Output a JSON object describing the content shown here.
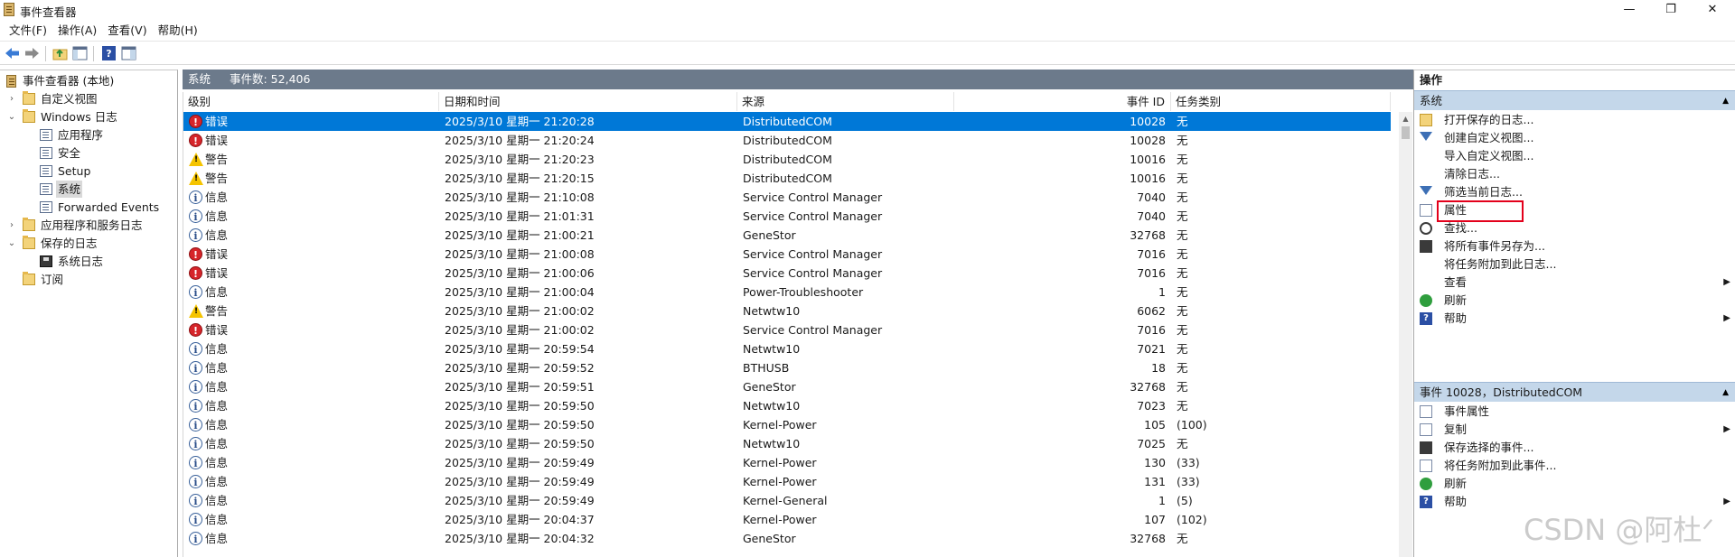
{
  "window": {
    "title": "事件查看器",
    "minimize": "—",
    "maximize": "❐",
    "close": "✕"
  },
  "menu": [
    "文件(F)",
    "操作(A)",
    "查看(V)",
    "帮助(H)"
  ],
  "tree": {
    "root": "事件查看器 (本地)",
    "custom_views": "自定义视图",
    "windows_logs": "Windows 日志",
    "app": "应用程序",
    "security": "安全",
    "setup": "Setup",
    "system": "系统",
    "forwarded": "Forwarded Events",
    "app_services": "应用程序和服务日志",
    "saved_logs": "保存的日志",
    "system_log": "系统日志",
    "subscriptions": "订阅"
  },
  "center": {
    "log_name": "系统",
    "event_count": "事件数: 52,406",
    "columns": {
      "level": "级别",
      "datetime": "日期和时间",
      "source": "来源",
      "event_id": "事件 ID",
      "task": "任务类别"
    },
    "rows": [
      {
        "level": "错误",
        "type": "err",
        "datetime": "2025/3/10 星期一 21:20:28",
        "source": "DistributedCOM",
        "id": "10028",
        "task": "无"
      },
      {
        "level": "错误",
        "type": "err",
        "datetime": "2025/3/10 星期一 21:20:24",
        "source": "DistributedCOM",
        "id": "10028",
        "task": "无"
      },
      {
        "level": "警告",
        "type": "warn",
        "datetime": "2025/3/10 星期一 21:20:23",
        "source": "DistributedCOM",
        "id": "10016",
        "task": "无"
      },
      {
        "level": "警告",
        "type": "warn",
        "datetime": "2025/3/10 星期一 21:20:15",
        "source": "DistributedCOM",
        "id": "10016",
        "task": "无"
      },
      {
        "level": "信息",
        "type": "info",
        "datetime": "2025/3/10 星期一 21:10:08",
        "source": "Service Control Manager",
        "id": "7040",
        "task": "无"
      },
      {
        "level": "信息",
        "type": "info",
        "datetime": "2025/3/10 星期一 21:01:31",
        "source": "Service Control Manager",
        "id": "7040",
        "task": "无"
      },
      {
        "level": "信息",
        "type": "info",
        "datetime": "2025/3/10 星期一 21:00:21",
        "source": "GeneStor",
        "id": "32768",
        "task": "无"
      },
      {
        "level": "错误",
        "type": "err",
        "datetime": "2025/3/10 星期一 21:00:08",
        "source": "Service Control Manager",
        "id": "7016",
        "task": "无"
      },
      {
        "level": "错误",
        "type": "err",
        "datetime": "2025/3/10 星期一 21:00:06",
        "source": "Service Control Manager",
        "id": "7016",
        "task": "无"
      },
      {
        "level": "信息",
        "type": "info",
        "datetime": "2025/3/10 星期一 21:00:04",
        "source": "Power-Troubleshooter",
        "id": "1",
        "task": "无"
      },
      {
        "level": "警告",
        "type": "warn",
        "datetime": "2025/3/10 星期一 21:00:02",
        "source": "Netwtw10",
        "id": "6062",
        "task": "无"
      },
      {
        "level": "错误",
        "type": "err",
        "datetime": "2025/3/10 星期一 21:00:02",
        "source": "Service Control Manager",
        "id": "7016",
        "task": "无"
      },
      {
        "level": "信息",
        "type": "info",
        "datetime": "2025/3/10 星期一 20:59:54",
        "source": "Netwtw10",
        "id": "7021",
        "task": "无"
      },
      {
        "level": "信息",
        "type": "info",
        "datetime": "2025/3/10 星期一 20:59:52",
        "source": "BTHUSB",
        "id": "18",
        "task": "无"
      },
      {
        "level": "信息",
        "type": "info",
        "datetime": "2025/3/10 星期一 20:59:51",
        "source": "GeneStor",
        "id": "32768",
        "task": "无"
      },
      {
        "level": "信息",
        "type": "info",
        "datetime": "2025/3/10 星期一 20:59:50",
        "source": "Netwtw10",
        "id": "7023",
        "task": "无"
      },
      {
        "level": "信息",
        "type": "info",
        "datetime": "2025/3/10 星期一 20:59:50",
        "source": "Kernel-Power",
        "id": "105",
        "task": "(100)"
      },
      {
        "level": "信息",
        "type": "info",
        "datetime": "2025/3/10 星期一 20:59:50",
        "source": "Netwtw10",
        "id": "7025",
        "task": "无"
      },
      {
        "level": "信息",
        "type": "info",
        "datetime": "2025/3/10 星期一 20:59:49",
        "source": "Kernel-Power",
        "id": "130",
        "task": "(33)"
      },
      {
        "level": "信息",
        "type": "info",
        "datetime": "2025/3/10 星期一 20:59:49",
        "source": "Kernel-Power",
        "id": "131",
        "task": "(33)"
      },
      {
        "level": "信息",
        "type": "info",
        "datetime": "2025/3/10 星期一 20:59:49",
        "source": "Kernel-General",
        "id": "1",
        "task": "(5)"
      },
      {
        "level": "信息",
        "type": "info",
        "datetime": "2025/3/10 星期一 20:04:37",
        "source": "Kernel-Power",
        "id": "107",
        "task": "(102)"
      },
      {
        "level": "信息",
        "type": "info",
        "datetime": "2025/3/10 星期一 20:04:32",
        "source": "GeneStor",
        "id": "32768",
        "task": "无"
      }
    ]
  },
  "actions": {
    "title": "操作",
    "section1": "系统",
    "items1": [
      {
        "label": "打开保存的日志...",
        "icon": "ic-open"
      },
      {
        "label": "创建自定义视图...",
        "icon": "ic-filter"
      },
      {
        "label": "导入自定义视图...",
        "icon": "ic-blank"
      },
      {
        "label": "清除日志...",
        "icon": "ic-blank"
      },
      {
        "label": "筛选当前日志...",
        "icon": "ic-filter"
      },
      {
        "label": "属性",
        "icon": "ic-props"
      },
      {
        "label": "查找...",
        "icon": "ic-find"
      },
      {
        "label": "将所有事件另存为...",
        "icon": "ic-save"
      },
      {
        "label": "将任务附加到此日志...",
        "icon": "ic-blank"
      },
      {
        "label": "查看",
        "icon": "ic-blank",
        "sub": true
      },
      {
        "label": "刷新",
        "icon": "ic-refresh"
      },
      {
        "label": "帮助",
        "icon": "ic-help",
        "sub": true
      }
    ],
    "section2": "事件 10028，DistributedCOM",
    "items2": [
      {
        "label": "事件属性",
        "icon": "ic-props"
      },
      {
        "label": "复制",
        "icon": "ic-props",
        "sub": true
      },
      {
        "label": "保存选择的事件...",
        "icon": "ic-save"
      },
      {
        "label": "将任务附加到此事件...",
        "icon": "ic-attach"
      },
      {
        "label": "刷新",
        "icon": "ic-refresh"
      },
      {
        "label": "帮助",
        "icon": "ic-help",
        "sub": true
      }
    ]
  },
  "watermark": "CSDN @阿杜ᐟ"
}
